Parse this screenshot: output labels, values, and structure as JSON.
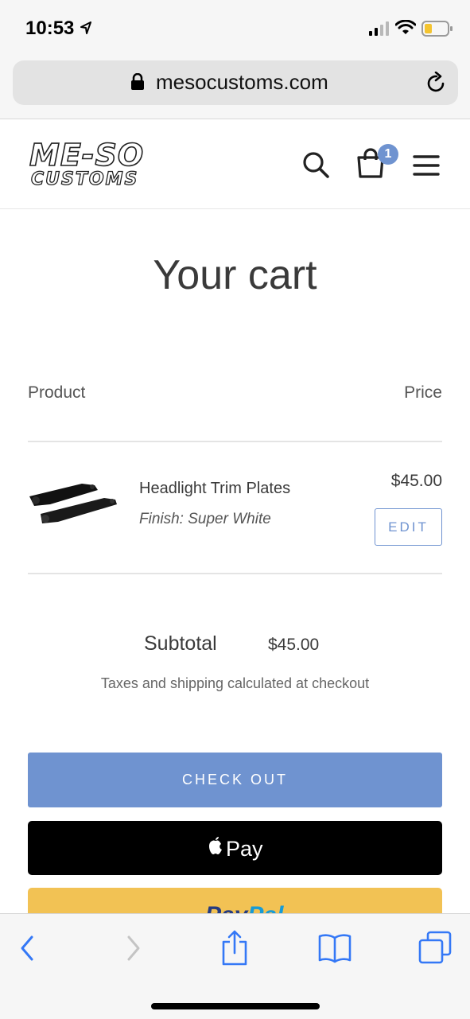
{
  "status_bar": {
    "time": "10:53"
  },
  "browser": {
    "url": "mesocustoms.com"
  },
  "header": {
    "logo_text": "ME-SO CUSTOMS",
    "cart_count": "1"
  },
  "page": {
    "title": "Your cart"
  },
  "cart_table": {
    "product_header": "Product",
    "price_header": "Price"
  },
  "items": [
    {
      "name": "Headlight Trim Plates",
      "finish": "Finish: Super White",
      "price": "$45.00",
      "edit_label": "EDIT"
    }
  ],
  "summary": {
    "subtotal_label": "Subtotal",
    "subtotal_value": "$45.00",
    "tax_note": "Taxes and shipping calculated at checkout"
  },
  "buttons": {
    "checkout_label": "CHECK OUT",
    "applepay_label": "Pay",
    "paypal_label_1": "Pay",
    "paypal_label_2": "Pal"
  },
  "colors": {
    "accent": "#6f93d0",
    "paypal_yellow": "#f2c254"
  }
}
